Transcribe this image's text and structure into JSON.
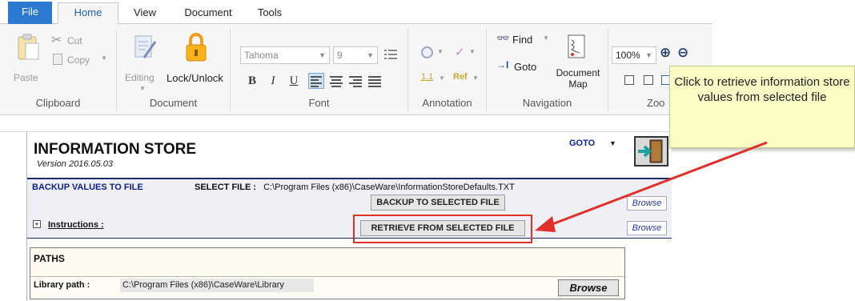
{
  "ribbon": {
    "tabs": [
      "File",
      "Home",
      "View",
      "Document",
      "Tools"
    ],
    "active_tab": "Home",
    "clipboard": {
      "paste": "Paste",
      "cut": "Cut",
      "copy": "Copy",
      "label": "Clipboard"
    },
    "document_group": {
      "editing": "Editing",
      "lock": "Lock/Unlock",
      "label": "Document"
    },
    "font": {
      "family": "Tahoma",
      "size": "9",
      "bold": "B",
      "italic": "I",
      "underline": "U",
      "label": "Font"
    },
    "annotation": {
      "label": "Annotation",
      "ref": "Ref"
    },
    "navigation": {
      "find": "Find",
      "goto": "Goto",
      "doc_map": "Document Map",
      "label": "Navigation"
    },
    "zoom": {
      "value": "100%",
      "label": "Zoo"
    }
  },
  "callout": {
    "text": "Click to retrieve information store values from selected file"
  },
  "page": {
    "title": "INFORMATION STORE",
    "version": "Version 2016.05.03",
    "goto_label": "GOTO",
    "backup_link": "BACKUP VALUES TO FILE",
    "select_file_label": "SELECT FILE :",
    "select_file_path": "C:\\Program Files (x86)\\CaseWare\\InformationStoreDefaults.TXT",
    "backup_button": "BACKUP TO SELECTED FILE",
    "retrieve_button": "RETRIEVE FROM SELECTED FILE",
    "browse": "Browse",
    "instructions_toggle": "+",
    "instructions": "Instructions :"
  },
  "paths": {
    "heading": "PATHS",
    "library_label": "Library path :",
    "library_value": "C:\\Program Files (x86)\\CaseWare\\Library",
    "browse": "Browse"
  },
  "colors": {
    "accent": "#2b79d0",
    "highlight": "#e0302a",
    "link": "#10208a",
    "callout_bg": "#fbfbc6"
  }
}
